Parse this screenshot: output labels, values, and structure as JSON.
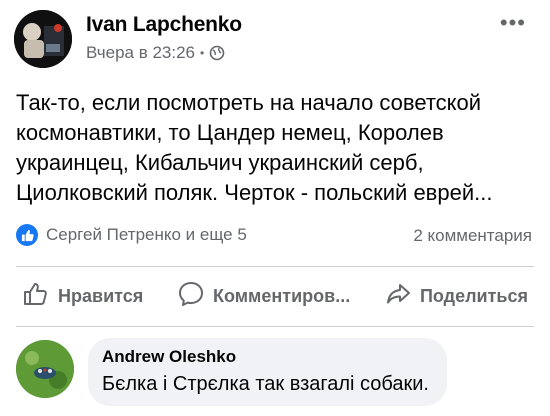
{
  "post": {
    "author": "Ivan Lapchenko",
    "time": "Вчера в 23:26",
    "privacy_icon": "globe-icon",
    "more_icon": "more-horizontal-icon",
    "text": "Так-то, если посмотреть на начало советской космонавтики, то Цандер немец, Королев украинцец, Кибальчич украинский серб, Циолковский поляк. Черток - польский еврей..."
  },
  "reactions": {
    "likes": "Сергей Петренко и еще 5",
    "comments_count": "2 комментария"
  },
  "actions": {
    "like": "Нравится",
    "comment": "Комментиров...",
    "share": "Поделиться"
  },
  "comment": {
    "author": "Andrew Oleshko",
    "text": "Бєлка і Стрєлка так взагалі собаки."
  },
  "colors": {
    "accent": "#1877f2",
    "secondary_text": "#65676b",
    "bubble": "#f0f2f5",
    "divider": "#ced0d4"
  }
}
